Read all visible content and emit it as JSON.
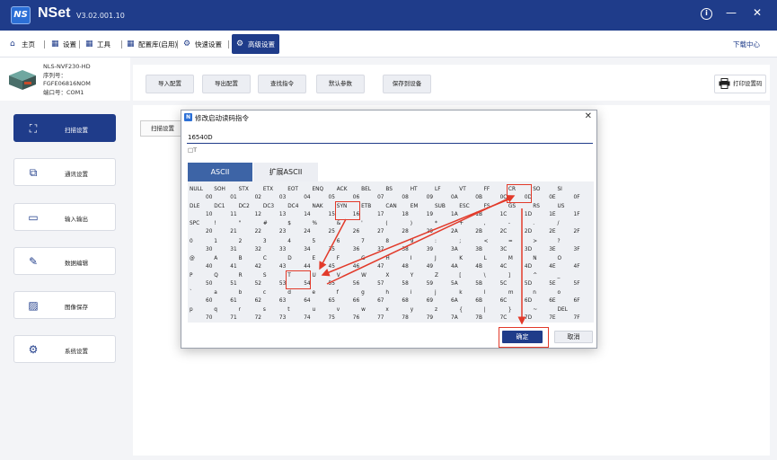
{
  "app": {
    "name": "NSet",
    "version": "V3.02.001.10",
    "logo_text": "NS"
  },
  "window_controls": {
    "info": "i",
    "minimize": "—",
    "close": "✕"
  },
  "menu": {
    "items": [
      {
        "label": "主页",
        "icon": "home-icon"
      },
      {
        "label": "设置",
        "icon": "grid-icon"
      },
      {
        "label": "工具",
        "icon": "grid-icon"
      },
      {
        "label": "配置库(启用)",
        "icon": "grid-icon"
      },
      {
        "label": "快速设置",
        "icon": "gear-icon"
      },
      {
        "label": "高级设置",
        "icon": "gear-icon",
        "active": true
      }
    ],
    "download_center": "下载中心"
  },
  "device": {
    "model": "NLS-NVF230-HD",
    "serial_label": "序列号：",
    "serial": "FGFE06816NOM",
    "port": "端口号：COM1"
  },
  "sidebar": {
    "items": [
      {
        "label": "扫描设置",
        "icon": "scan-icon",
        "active": true
      },
      {
        "label": "通讯设置",
        "icon": "communication-icon"
      },
      {
        "label": "输入输出",
        "icon": "monitor-icon"
      },
      {
        "label": "数据编辑",
        "icon": "edit-icon"
      },
      {
        "label": "图像保存",
        "icon": "image-icon"
      },
      {
        "label": "系统设置",
        "icon": "system-icon"
      }
    ]
  },
  "toolbar": {
    "buttons": [
      "导入配置",
      "导出配置",
      "查找指令",
      "默认参数",
      "保存到设备"
    ],
    "print": "打印设置码"
  },
  "content": {
    "tab_label": "扫描设置"
  },
  "dialog": {
    "title": "修改启动读码指令",
    "icon_text": "N",
    "close": "✕",
    "input_value": "16540D",
    "text_value": "□T",
    "tabs": [
      "ASCII",
      "扩展ASCII"
    ],
    "ok": "确定",
    "cancel": "取消",
    "ascii_rows": [
      [
        [
          "NULL",
          "00"
        ],
        [
          "SOH",
          "01"
        ],
        [
          "STX",
          "02"
        ],
        [
          "ETX",
          "03"
        ],
        [
          "EOT",
          "04"
        ],
        [
          "ENQ",
          "05"
        ],
        [
          "ACK",
          "06"
        ],
        [
          "BEL",
          "07"
        ],
        [
          "BS",
          "08"
        ],
        [
          "HT",
          "09"
        ],
        [
          "LF",
          "0A"
        ],
        [
          "VT",
          "0B"
        ],
        [
          "FF",
          "0C"
        ],
        [
          "CR",
          "0D"
        ],
        [
          "SO",
          "0E"
        ],
        [
          "SI",
          "0F"
        ]
      ],
      [
        [
          "DLE",
          "10"
        ],
        [
          "DC1",
          "11"
        ],
        [
          "DC2",
          "12"
        ],
        [
          "DC3",
          "13"
        ],
        [
          "DC4",
          "14"
        ],
        [
          "NAK",
          "15"
        ],
        [
          "SYN",
          "16"
        ],
        [
          "ETB",
          "17"
        ],
        [
          "CAN",
          "18"
        ],
        [
          "EM",
          "19"
        ],
        [
          "SUB",
          "1A"
        ],
        [
          "ESC",
          "1B"
        ],
        [
          "FS",
          "1C"
        ],
        [
          "GS",
          "1D"
        ],
        [
          "RS",
          "1E"
        ],
        [
          "US",
          "1F"
        ]
      ],
      [
        [
          "SPC",
          "20"
        ],
        [
          "!",
          "21"
        ],
        [
          "\"",
          "22"
        ],
        [
          "#",
          "23"
        ],
        [
          "$",
          "24"
        ],
        [
          "%",
          "25"
        ],
        [
          "&",
          "26"
        ],
        [
          "'",
          "27"
        ],
        [
          "(",
          "28"
        ],
        [
          ")",
          "29"
        ],
        [
          "*",
          "2A"
        ],
        [
          "+",
          "2B"
        ],
        [
          ",",
          "2C"
        ],
        [
          "-",
          "2D"
        ],
        [
          ".",
          "2E"
        ],
        [
          "/",
          "2F"
        ]
      ],
      [
        [
          "0",
          "30"
        ],
        [
          "1",
          "31"
        ],
        [
          "2",
          "32"
        ],
        [
          "3",
          "33"
        ],
        [
          "4",
          "34"
        ],
        [
          "5",
          "35"
        ],
        [
          "6",
          "36"
        ],
        [
          "7",
          "37"
        ],
        [
          "8",
          "38"
        ],
        [
          "9",
          "39"
        ],
        [
          ":",
          "3A"
        ],
        [
          ";",
          "3B"
        ],
        [
          "<",
          "3C"
        ],
        [
          "=",
          "3D"
        ],
        [
          ">",
          "3E"
        ],
        [
          "?",
          "3F"
        ]
      ],
      [
        [
          "@",
          "40"
        ],
        [
          "A",
          "41"
        ],
        [
          "B",
          "42"
        ],
        [
          "C",
          "43"
        ],
        [
          "D",
          "44"
        ],
        [
          "E",
          "45"
        ],
        [
          "F",
          "46"
        ],
        [
          "G",
          "47"
        ],
        [
          "H",
          "48"
        ],
        [
          "I",
          "49"
        ],
        [
          "J",
          "4A"
        ],
        [
          "K",
          "4B"
        ],
        [
          "L",
          "4C"
        ],
        [
          "M",
          "4D"
        ],
        [
          "N",
          "4E"
        ],
        [
          "O",
          "4F"
        ]
      ],
      [
        [
          "P",
          "50"
        ],
        [
          "Q",
          "51"
        ],
        [
          "R",
          "52"
        ],
        [
          "S",
          "53"
        ],
        [
          "T",
          "54"
        ],
        [
          "U",
          "55"
        ],
        [
          "V",
          "56"
        ],
        [
          "W",
          "57"
        ],
        [
          "X",
          "58"
        ],
        [
          "Y",
          "59"
        ],
        [
          "Z",
          "5A"
        ],
        [
          "[",
          "5B"
        ],
        [
          "\\",
          "5C"
        ],
        [
          "]",
          "5D"
        ],
        [
          "^",
          "5E"
        ],
        [
          "_",
          "5F"
        ]
      ],
      [
        [
          "`",
          "60"
        ],
        [
          "a",
          "61"
        ],
        [
          "b",
          "62"
        ],
        [
          "c",
          "63"
        ],
        [
          "d",
          "64"
        ],
        [
          "e",
          "65"
        ],
        [
          "f",
          "66"
        ],
        [
          "g",
          "67"
        ],
        [
          "h",
          "68"
        ],
        [
          "i",
          "69"
        ],
        [
          "j",
          "6A"
        ],
        [
          "k",
          "6B"
        ],
        [
          "l",
          "6C"
        ],
        [
          "m",
          "6D"
        ],
        [
          "n",
          "6E"
        ],
        [
          "o",
          "6F"
        ]
      ],
      [
        [
          "p",
          "70"
        ],
        [
          "q",
          "71"
        ],
        [
          "r",
          "72"
        ],
        [
          "s",
          "73"
        ],
        [
          "t",
          "74"
        ],
        [
          "u",
          "75"
        ],
        [
          "v",
          "76"
        ],
        [
          "w",
          "77"
        ],
        [
          "x",
          "78"
        ],
        [
          "y",
          "79"
        ],
        [
          "z",
          "7A"
        ],
        [
          "{",
          "7B"
        ],
        [
          "|",
          "7C"
        ],
        [
          "}",
          "7D"
        ],
        [
          "~",
          "7E"
        ],
        [
          "DEL",
          "7F"
        ]
      ]
    ],
    "highlighted": [
      "16",
      "54",
      "0D"
    ],
    "highlight_color": "#e23a2a"
  },
  "colors": {
    "primary": "#1f3c8a",
    "tab_active": "#3d64a6",
    "annotation": "#e23a2a"
  }
}
